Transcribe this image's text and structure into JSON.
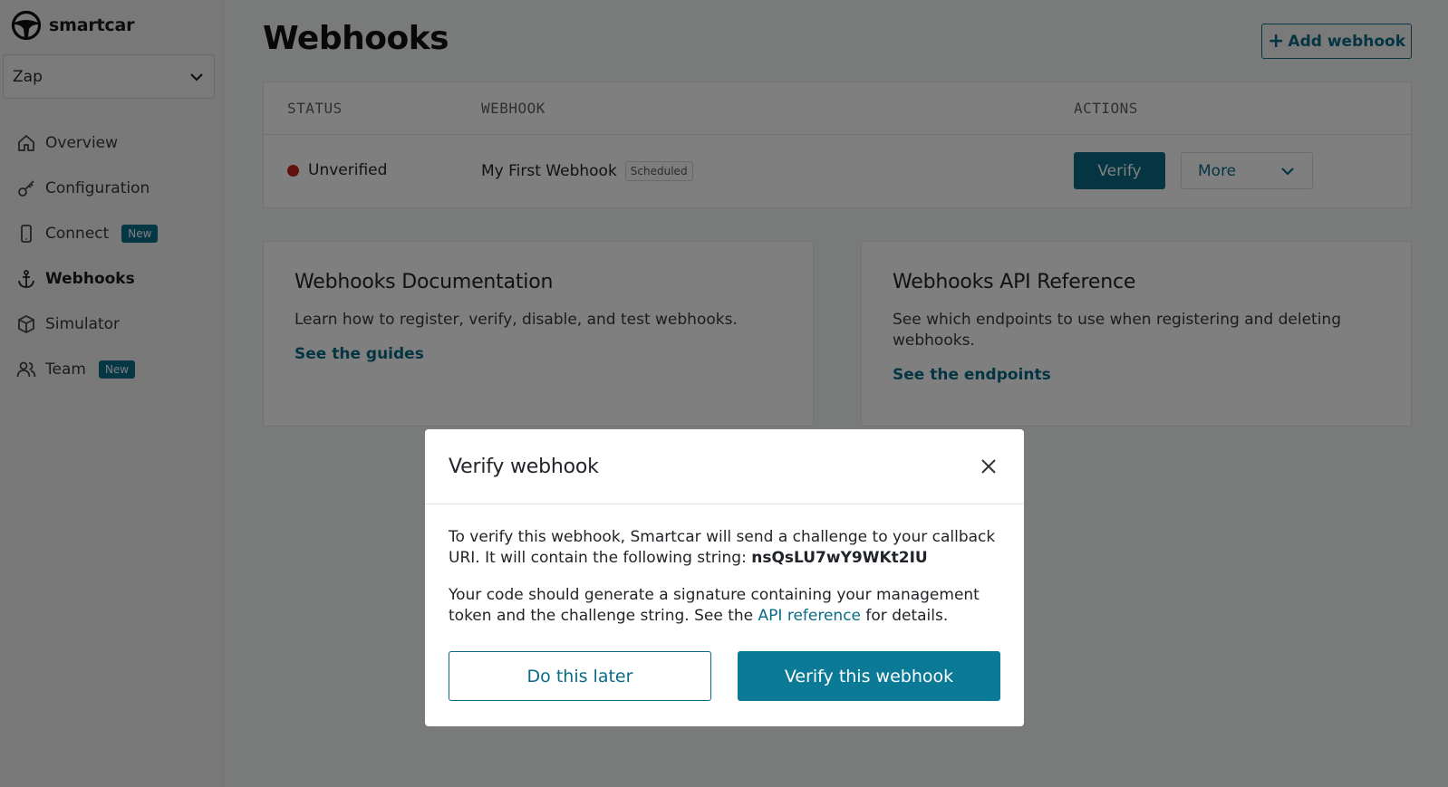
{
  "brand": {
    "name": "smartcar"
  },
  "app_selector": {
    "value": "Zap"
  },
  "nav": {
    "items": [
      {
        "label": "Overview",
        "icon": "home-icon"
      },
      {
        "label": "Configuration",
        "icon": "key-icon"
      },
      {
        "label": "Connect",
        "icon": "phone-icon",
        "badge": "New"
      },
      {
        "label": "Webhooks",
        "icon": "anchor-icon",
        "active": true
      },
      {
        "label": "Simulator",
        "icon": "cube-icon"
      },
      {
        "label": "Team",
        "icon": "users-icon",
        "badge": "New"
      }
    ]
  },
  "page": {
    "title": "Webhooks",
    "add_button": "Add webhook"
  },
  "table": {
    "headers": {
      "status": "STATUS",
      "webhook": "WEBHOOK",
      "actions": "ACTIONS"
    },
    "rows": [
      {
        "status": "Unverified",
        "status_color": "#c0231b",
        "name": "My First Webhook",
        "tag": "Scheduled",
        "verify_label": "Verify",
        "more_label": "More"
      }
    ]
  },
  "cards": [
    {
      "title": "Webhooks Documentation",
      "text": "Learn how to register, verify, disable, and test webhooks.",
      "link": "See the guides"
    },
    {
      "title": "Webhooks API Reference",
      "text": "See which endpoints to use when registering and deleting webhooks.",
      "link": "See the endpoints"
    }
  ],
  "modal": {
    "title": "Verify webhook",
    "p1_text": "To verify this webhook, Smartcar will send a challenge to your callback URI. It will contain the following string: ",
    "challenge": "nsQsLU7wY9WKt2IU",
    "p2_before": "Your code should generate a signature containing your management token and the challenge string. See the ",
    "p2_link": "API reference",
    "p2_after": " for details.",
    "later_label": "Do this later",
    "verify_label": "Verify this webhook"
  },
  "colors": {
    "accent": "#0b6b86",
    "unverified": "#c0231b"
  }
}
